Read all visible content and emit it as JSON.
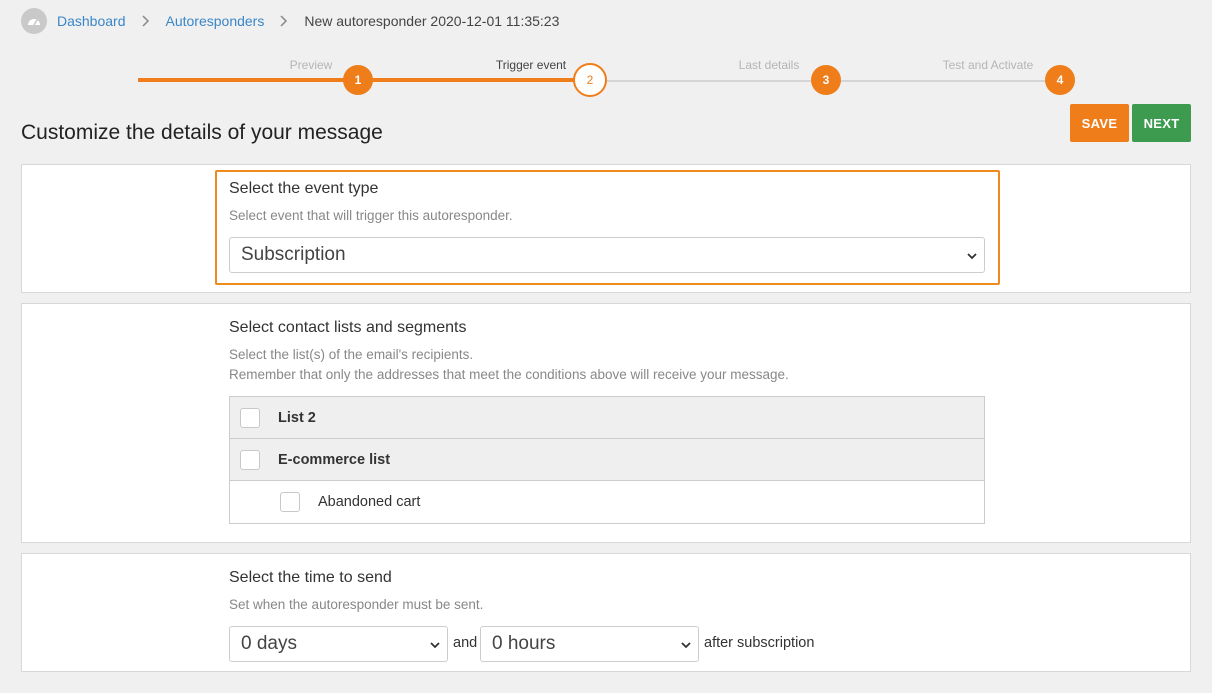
{
  "breadcrumb": {
    "home_icon": "dashboard-gauge-icon",
    "items": [
      "Dashboard",
      "Autoresponders"
    ],
    "current": "New autoresponder 2020-12-01 11:35:23"
  },
  "stepper": {
    "steps": [
      {
        "label": "Preview",
        "number": "1",
        "state": "done"
      },
      {
        "label": "Trigger event",
        "number": "2",
        "state": "current"
      },
      {
        "label": "Last details",
        "number": "3",
        "state": "upcoming"
      },
      {
        "label": "Test and Activate",
        "number": "4",
        "state": "upcoming"
      }
    ],
    "accent_color": "#ef7d1a"
  },
  "header": {
    "title": "Customize the details of your message",
    "save_label": "SAVE",
    "next_label": "NEXT"
  },
  "event_type": {
    "title": "Select the event type",
    "description": "Select event that will trigger this autoresponder.",
    "selected": "Subscription"
  },
  "contact_lists": {
    "title": "Select contact lists and segments",
    "description_1": "Select the list(s) of the email's recipients.",
    "description_2": "Remember that only the addresses that meet the conditions above will receive your message.",
    "rows": [
      {
        "label": "List 2",
        "kind": "list"
      },
      {
        "label": "E-commerce list",
        "kind": "list"
      },
      {
        "label": "Abandoned cart",
        "kind": "segment"
      }
    ]
  },
  "send_time": {
    "title": "Select the time to send",
    "description": "Set when the autoresponder must be sent.",
    "days_selected": "0 days",
    "and_label": "and",
    "hours_selected": "0 hours",
    "suffix": "after subscription"
  },
  "colors": {
    "orange": "#ef7d1a",
    "green": "#3c9b4f",
    "link": "#3a86c8"
  }
}
